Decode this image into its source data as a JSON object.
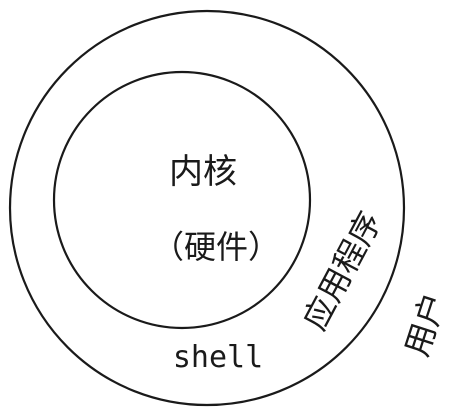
{
  "diagram": {
    "kernel_label": "内核",
    "hardware_label": "（硬件）",
    "shell_label": "shell",
    "app_label": "应用程序",
    "user_label": "用户"
  },
  "colors": {
    "stroke": "#1a1a1a",
    "text": "#1a1a1a",
    "background": "#ffffff"
  }
}
